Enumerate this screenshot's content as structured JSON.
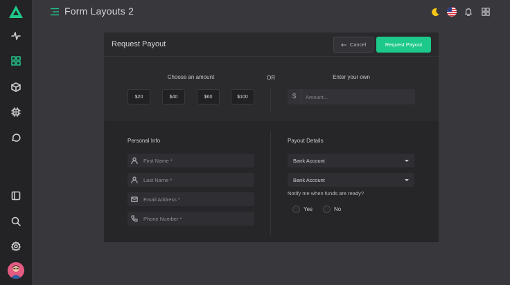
{
  "topbar": {
    "page_title": "Form Layouts 2"
  },
  "sidebar": {
    "items": [
      {
        "icon": "activity-icon",
        "active": false
      },
      {
        "icon": "grid-icon",
        "active": true
      },
      {
        "icon": "box-icon",
        "active": false
      },
      {
        "icon": "chip-icon",
        "active": false
      },
      {
        "icon": "chat-icon",
        "active": false
      }
    ],
    "bottom_items": [
      {
        "icon": "sidebar-icon"
      },
      {
        "icon": "search-icon"
      },
      {
        "icon": "gear-icon"
      }
    ]
  },
  "card": {
    "title": "Request Payout",
    "cancel_label": "Cancel",
    "primary_label": "Request Payout",
    "choose_label": "Choose an amount",
    "or_label": "OR",
    "enter_label": "Enter your own",
    "amounts": [
      "$20",
      "$40",
      "$60",
      "$100"
    ],
    "amount_placeholder": "Amount...",
    "currency_symbol": "$",
    "personal_info_label": "Personal Info",
    "payout_details_label": "Payout Details",
    "fields": {
      "first_name": "First Name *",
      "last_name": "Last Name *",
      "email": "Email Address *",
      "phone": "Phone Number *"
    },
    "selects": [
      "Bank Account",
      "Bank Account"
    ],
    "notify_label": "Notify me when funds are ready?",
    "radio_yes": "Yes",
    "radio_no": "No"
  },
  "colors": {
    "accent": "#1dc98a",
    "background": "#38383c",
    "sidebar": "#232326",
    "card": "#262629"
  }
}
